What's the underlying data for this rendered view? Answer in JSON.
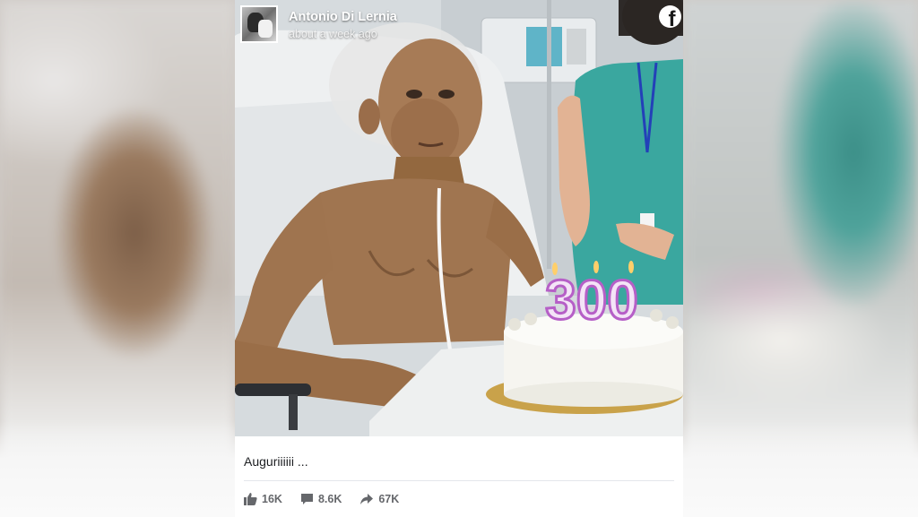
{
  "post": {
    "author": "Antonio Di Lernia",
    "timestamp": "about a week ago",
    "caption": "Auguriiiiii ...",
    "cake_number": "300"
  },
  "stats": {
    "likes": "16K",
    "comments": "8.6K",
    "shares": "67K"
  },
  "icons": {
    "platform": "facebook-icon",
    "like": "thumbs-up-icon",
    "comment": "speech-bubble-icon",
    "share": "share-arrow-icon"
  },
  "colors": {
    "card_background": "#ffffff",
    "stat_text": "#65676b",
    "caption_text": "#1c1e21",
    "candle_purple": "#b65fc7",
    "scrubs_teal": "#3aa79f"
  }
}
